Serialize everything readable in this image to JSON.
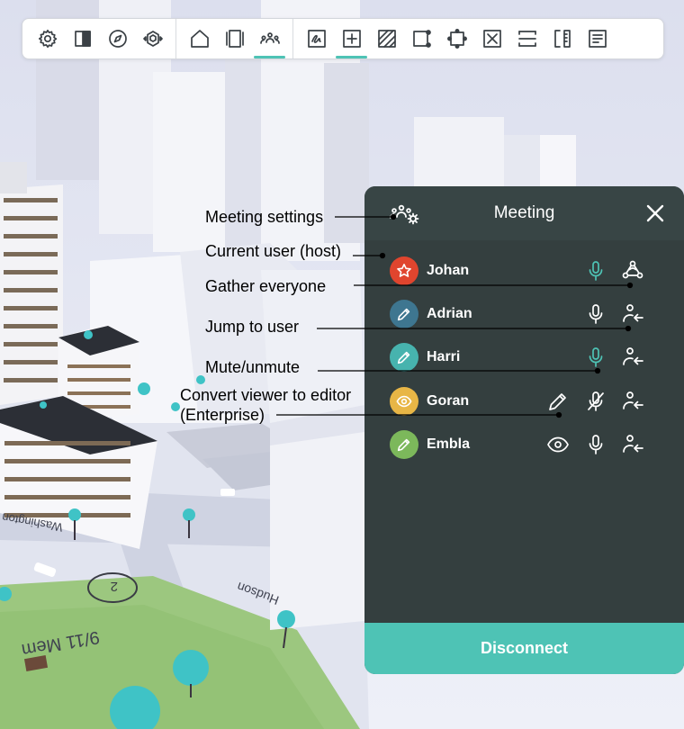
{
  "toolbar": {
    "icons": [
      "gear-icon",
      "split-panel-icon",
      "compass-icon",
      "view-cube-icon",
      "home-icon",
      "panels-icon",
      "meeting-icon",
      "sketch-icon",
      "add-icon",
      "hatch-icon",
      "select-shape-icon",
      "transform-icon",
      "delete-box-icon",
      "split-horizontal-icon",
      "measure-icon",
      "document-icon"
    ],
    "active": [
      "meeting-icon",
      "add-icon"
    ]
  },
  "panel": {
    "title": "Meeting",
    "disconnect_label": "Disconnect",
    "users": [
      {
        "name": "Johan",
        "avatar_color": "#e0452e",
        "avatar_icon": "star-icon",
        "mic": "active",
        "action": "gather-everyone-icon"
      },
      {
        "name": "Adrian",
        "avatar_color": "#3e7690",
        "avatar_icon": "pencil-icon",
        "mic": "on",
        "action": "jump-to-user-icon"
      },
      {
        "name": "Harri",
        "avatar_color": "#47b3ae",
        "avatar_icon": "pencil-icon",
        "mic": "active",
        "action": "jump-to-user-icon"
      },
      {
        "name": "Goran",
        "avatar_color": "#e8b646",
        "avatar_icon": "eye-icon",
        "mic": "muted",
        "action": "jump-to-user-icon",
        "role_toggle": "pencil-icon"
      },
      {
        "name": "Embla",
        "avatar_color": "#7cb85b",
        "avatar_icon": "pencil-icon",
        "mic": "on",
        "action": "jump-to-user-icon",
        "role_toggle": "eye-icon"
      }
    ]
  },
  "callouts": {
    "meeting_settings": "Meeting settings",
    "current_user": "Current user (host)",
    "gather_everyone": "Gather everyone",
    "jump_to_user": "Jump to user",
    "mute_unmute": "Mute/unmute",
    "convert_line1": "Convert viewer to editor",
    "convert_line2": "(Enterprise)"
  },
  "map_labels": [
    "9/11 Mem",
    "2",
    "Hudson",
    "Washington"
  ],
  "colors": {
    "accent": "#4ec3b5",
    "panel": "#2f3a3a",
    "header": "#384545"
  }
}
